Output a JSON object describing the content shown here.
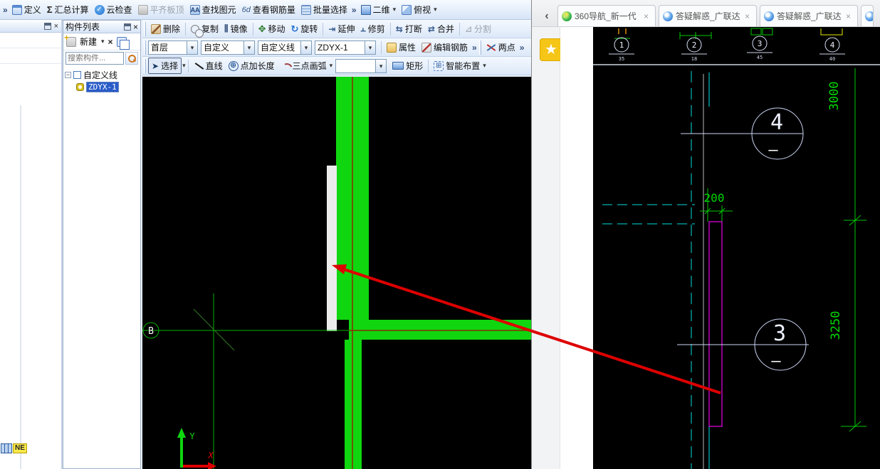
{
  "icons": {
    "overflow": "»",
    "collapse": "‹",
    "dropdown": "▾",
    "close": "×",
    "sigma": "Σ",
    "check": "✓",
    "star": "★",
    "plus_circle": "⊕",
    "cursor": "➤",
    "minus": "−",
    "mirror": "⫼",
    "move": "✥",
    "rotate": "↻",
    "extend": "⇥",
    "trim": "⫠",
    "break": "⇆",
    "merge": "⇄",
    "split": "⊿",
    "find": "AA",
    "glasses": "6d",
    "smart": "⊞"
  },
  "app": {
    "toolbar_top": {
      "define": "定义",
      "summary": "汇总计算",
      "cloud_check": "云检查",
      "align_slab_top": "平齐板顶",
      "find_element": "查找图元",
      "view_rebar": "查看钢筋量",
      "batch_select": "批量选择",
      "view_2d": "二维",
      "view_top": "俯视"
    },
    "edit_toolbar": {
      "delete": "删除",
      "copy": "复制",
      "mirror": "镜像",
      "move": "移动",
      "rotate": "旋转",
      "extend": "延伸",
      "trim": "修剪",
      "break": "打断",
      "merge": "合并",
      "split": "分割"
    },
    "context_toolbar": {
      "floor": "首层",
      "category": "自定义",
      "type": "自定义线",
      "element": "ZDYX-1",
      "properties": "属性",
      "edit_rebar": "编辑钢筋",
      "two_point": "两点"
    },
    "draw_toolbar": {
      "select": "选择",
      "line": "直线",
      "point_length": "点加长度",
      "arc_3pt": "三点画弧",
      "rectangle": "矩形",
      "smart_layout": "智能布置"
    },
    "component_panel": {
      "title": "构件列表",
      "new": "新建",
      "search_placeholder": "搜索构件...",
      "tree_root": "自定义线",
      "tree_item": "ZDYX-1"
    },
    "canvas": {
      "grid_label": "B",
      "ucs_y": "Y",
      "ucs_x": "X"
    },
    "ne_badge": "NE"
  },
  "browser": {
    "tabs": [
      {
        "label": "360导航_新一代"
      },
      {
        "label": "答疑解惑_广联达"
      },
      {
        "label": "答疑解惑_广联达"
      }
    ],
    "drawing": {
      "top_bubbles": [
        {
          "num": "1",
          "sub": "35"
        },
        {
          "num": "2",
          "sub": "18"
        },
        {
          "num": "3",
          "sub": "45"
        },
        {
          "num": "4",
          "sub": "40"
        }
      ],
      "bubble_top": {
        "num": "4",
        "dash": "—"
      },
      "bubble_bottom": {
        "num": "3",
        "dash": "—"
      },
      "dim_vertical_top": "3000",
      "dim_vertical_bottom": "3250",
      "dim_width": "200"
    }
  }
}
